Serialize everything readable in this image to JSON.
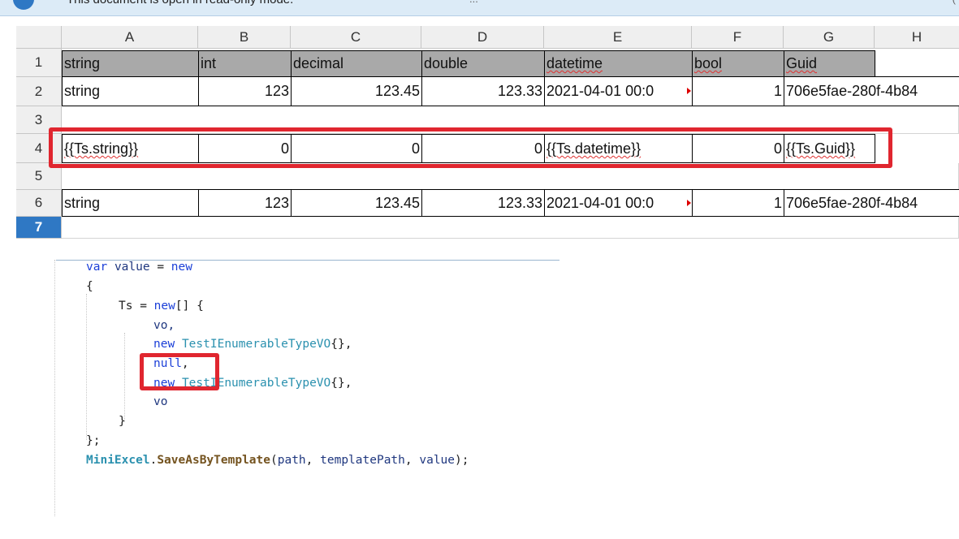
{
  "infobar": {
    "message": "This document is open in read-only mode.",
    "dots": "...",
    "right_glyph": "("
  },
  "sheet": {
    "columns": [
      "A",
      "B",
      "C",
      "D",
      "E",
      "F",
      "G",
      "H"
    ],
    "rows": [
      "1",
      "2",
      "3",
      "4",
      "5",
      "6",
      "7"
    ],
    "row1": [
      "string",
      "int",
      "decimal",
      "double",
      "datetime",
      "bool",
      "Guid"
    ],
    "row2": [
      "string",
      "123",
      "123.45",
      "123.33",
      "2021-04-01 00:0",
      "1",
      "706e5fae-280f-4b84"
    ],
    "row4": [
      "{{Ts.string}}",
      "0",
      "0",
      "0",
      "{{Ts.datetime}}",
      "0",
      "{{Ts.Guid}}"
    ],
    "row6": [
      "string",
      "123",
      "123.45",
      "123.33",
      "2021-04-01 00:0",
      "1",
      "706e5fae-280f-4b84"
    ]
  },
  "code": {
    "l1_kw": "var",
    "l1_name": "value",
    "l1_eq": " = ",
    "l1_new": "new",
    "l2": "{",
    "l3_name": "Ts",
    "l3_eq": " = ",
    "l3_new": "new",
    "l3_rest": "[] {",
    "l4": "vo,",
    "l5_new": "new",
    "l5_type": "TestIEnumerableTypeVO",
    "l5_rest": "{},",
    "l6_null": "null",
    "l6_rest": ",",
    "l7_new": "new",
    "l7_type": "TestIEnumerableTypeVO",
    "l7_rest": "{},",
    "l8": "vo",
    "l9": "}",
    "l10": "};",
    "l11_cls": "MiniExcel",
    "l11_dot": ".",
    "l11_method": "SaveAsByTemplate",
    "l11_open": "(",
    "l11_arg1": "path",
    "l11_sep1": ", ",
    "l11_arg2": "templatePath",
    "l11_sep2": ", ",
    "l11_arg3": "value",
    "l11_close": ");"
  }
}
